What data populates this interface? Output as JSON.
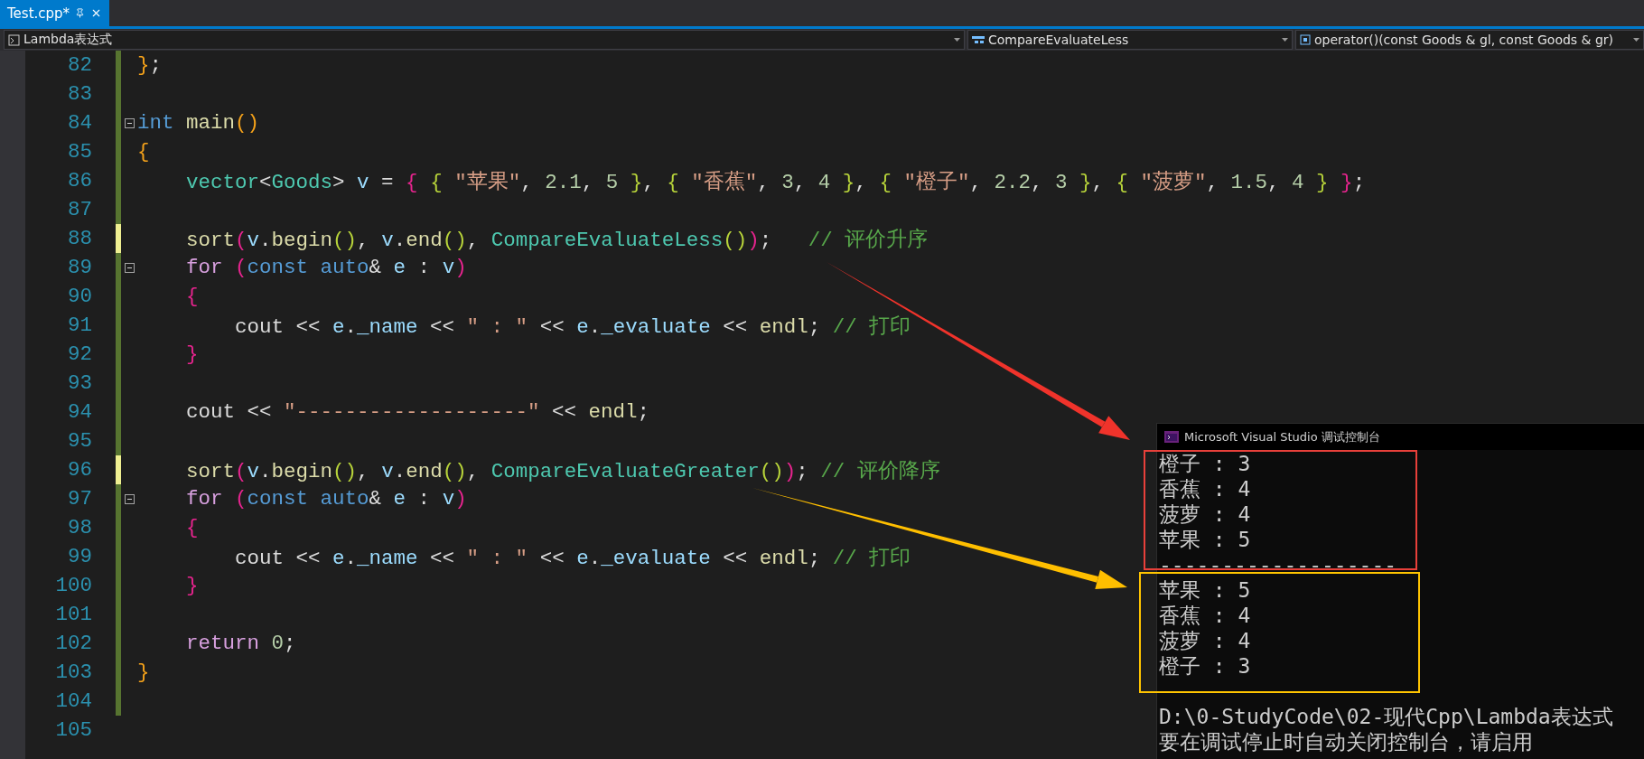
{
  "tab": {
    "label": "Test.cpp*",
    "selected": true
  },
  "navigation": [
    {
      "kind": "scope",
      "label": "Lambda表达式"
    },
    {
      "kind": "class",
      "label": "CompareEvaluateLess"
    },
    {
      "kind": "member",
      "label": "operator()(const Goods & gl, const Goods & gr)"
    }
  ],
  "lines": [
    {
      "number": "82",
      "fold": false,
      "changed": true,
      "unsaved": false,
      "tokens": [
        {
          "kind": "bracket1",
          "text": "}"
        },
        {
          "kind": "plain",
          "text": ";"
        }
      ]
    },
    {
      "number": "83",
      "fold": false,
      "changed": true,
      "unsaved": false
    },
    {
      "number": "84",
      "fold": true,
      "changed": true,
      "unsaved": false,
      "tokens": [
        {
          "kind": "keyword",
          "text": "int "
        },
        {
          "kind": "function",
          "text": "main"
        },
        {
          "kind": "bracket1",
          "text": "()"
        }
      ]
    },
    {
      "number": "85",
      "fold": false,
      "changed": true,
      "unsaved": false,
      "tokens": [
        {
          "kind": "bracket1",
          "text": "{"
        }
      ]
    },
    {
      "number": "86",
      "fold": false,
      "changed": true,
      "unsaved": false,
      "tokens": [
        {
          "kind": "type",
          "text": "    vector"
        },
        {
          "kind": "plain",
          "text": "<"
        },
        {
          "kind": "type",
          "text": "Goods"
        },
        {
          "kind": "plain",
          "text": "> "
        },
        {
          "kind": "variable",
          "text": "v"
        },
        {
          "kind": "plain",
          "text": " = "
        },
        {
          "kind": "bracket2",
          "text": "{ "
        },
        {
          "kind": "bracket3",
          "text": "{ "
        },
        {
          "kind": "string",
          "text": "\"苹果\""
        },
        {
          "kind": "plain",
          "text": ", "
        },
        {
          "kind": "number",
          "text": "2.1"
        },
        {
          "kind": "plain",
          "text": ", "
        },
        {
          "kind": "number",
          "text": "5 "
        },
        {
          "kind": "bracket3",
          "text": "}"
        },
        {
          "kind": "plain",
          "text": ", "
        },
        {
          "kind": "bracket3",
          "text": "{ "
        },
        {
          "kind": "string",
          "text": "\"香蕉\""
        },
        {
          "kind": "plain",
          "text": ", "
        },
        {
          "kind": "number",
          "text": "3"
        },
        {
          "kind": "plain",
          "text": ", "
        },
        {
          "kind": "number",
          "text": "4 "
        },
        {
          "kind": "bracket3",
          "text": "}"
        },
        {
          "kind": "plain",
          "text": ", "
        },
        {
          "kind": "bracket3",
          "text": "{ "
        },
        {
          "kind": "string",
          "text": "\"橙子\""
        },
        {
          "kind": "plain",
          "text": ", "
        },
        {
          "kind": "number",
          "text": "2.2"
        },
        {
          "kind": "plain",
          "text": ", "
        },
        {
          "kind": "number",
          "text": "3 "
        },
        {
          "kind": "bracket3",
          "text": "}"
        },
        {
          "kind": "plain",
          "text": ", "
        },
        {
          "kind": "bracket3",
          "text": "{ "
        },
        {
          "kind": "string",
          "text": "\"菠萝\""
        },
        {
          "kind": "plain",
          "text": ", "
        },
        {
          "kind": "number",
          "text": "1.5"
        },
        {
          "kind": "plain",
          "text": ", "
        },
        {
          "kind": "number",
          "text": "4 "
        },
        {
          "kind": "bracket3",
          "text": "} "
        },
        {
          "kind": "bracket2",
          "text": "}"
        },
        {
          "kind": "plain",
          "text": ";"
        }
      ]
    },
    {
      "number": "87",
      "fold": false,
      "changed": true,
      "unsaved": false
    },
    {
      "number": "88",
      "fold": false,
      "changed": true,
      "unsaved": true,
      "tokens": [
        {
          "kind": "function",
          "text": "    sort"
        },
        {
          "kind": "bracket2",
          "text": "("
        },
        {
          "kind": "variable",
          "text": "v"
        },
        {
          "kind": "plain",
          "text": "."
        },
        {
          "kind": "function",
          "text": "begin"
        },
        {
          "kind": "bracket3",
          "text": "()"
        },
        {
          "kind": "plain",
          "text": ", "
        },
        {
          "kind": "variable",
          "text": "v"
        },
        {
          "kind": "plain",
          "text": "."
        },
        {
          "kind": "function",
          "text": "end"
        },
        {
          "kind": "bracket3",
          "text": "()"
        },
        {
          "kind": "plain",
          "text": ", "
        },
        {
          "kind": "type",
          "text": "CompareEvaluateLess"
        },
        {
          "kind": "bracket3",
          "text": "()"
        },
        {
          "kind": "bracket2",
          "text": ")"
        },
        {
          "kind": "plain",
          "text": ";   "
        },
        {
          "kind": "comment",
          "text": "// 评价升序"
        }
      ]
    },
    {
      "number": "89",
      "fold": true,
      "changed": true,
      "unsaved": false,
      "tokens": [
        {
          "kind": "control",
          "text": "    for "
        },
        {
          "kind": "bracket2",
          "text": "("
        },
        {
          "kind": "keyword",
          "text": "const auto"
        },
        {
          "kind": "plain",
          "text": "& "
        },
        {
          "kind": "variable",
          "text": "e"
        },
        {
          "kind": "plain",
          "text": " : "
        },
        {
          "kind": "variable",
          "text": "v"
        },
        {
          "kind": "bracket2",
          "text": ")"
        }
      ]
    },
    {
      "number": "90",
      "fold": false,
      "changed": true,
      "unsaved": false,
      "tokens": [
        {
          "kind": "bracket2",
          "text": "    {"
        }
      ]
    },
    {
      "number": "91",
      "fold": false,
      "changed": true,
      "unsaved": false,
      "tokens": [
        {
          "kind": "plain",
          "text": "        cout << "
        },
        {
          "kind": "variable",
          "text": "e"
        },
        {
          "kind": "plain",
          "text": "."
        },
        {
          "kind": "variable",
          "text": "_name"
        },
        {
          "kind": "plain",
          "text": " << "
        },
        {
          "kind": "string",
          "text": "\" : \""
        },
        {
          "kind": "plain",
          "text": " << "
        },
        {
          "kind": "variable",
          "text": "e"
        },
        {
          "kind": "plain",
          "text": "."
        },
        {
          "kind": "variable",
          "text": "_evaluate"
        },
        {
          "kind": "plain",
          "text": " << "
        },
        {
          "kind": "function",
          "text": "endl"
        },
        {
          "kind": "plain",
          "text": "; "
        },
        {
          "kind": "comment",
          "text": "// 打印"
        }
      ]
    },
    {
      "number": "92",
      "fold": false,
      "changed": true,
      "unsaved": false,
      "tokens": [
        {
          "kind": "bracket2",
          "text": "    }"
        }
      ]
    },
    {
      "number": "93",
      "fold": false,
      "changed": true,
      "unsaved": false
    },
    {
      "number": "94",
      "fold": false,
      "changed": true,
      "unsaved": false,
      "tokens": [
        {
          "kind": "plain",
          "text": "    cout << "
        },
        {
          "kind": "string",
          "text": "\"-------------------\""
        },
        {
          "kind": "plain",
          "text": " << "
        },
        {
          "kind": "function",
          "text": "endl"
        },
        {
          "kind": "plain",
          "text": ";"
        }
      ]
    },
    {
      "number": "95",
      "fold": false,
      "changed": true,
      "unsaved": false
    },
    {
      "number": "96",
      "fold": false,
      "changed": true,
      "unsaved": true,
      "tokens": [
        {
          "kind": "function",
          "text": "    sort"
        },
        {
          "kind": "bracket2",
          "text": "("
        },
        {
          "kind": "variable",
          "text": "v"
        },
        {
          "kind": "plain",
          "text": "."
        },
        {
          "kind": "function",
          "text": "begin"
        },
        {
          "kind": "bracket3",
          "text": "()"
        },
        {
          "kind": "plain",
          "text": ", "
        },
        {
          "kind": "variable",
          "text": "v"
        },
        {
          "kind": "plain",
          "text": "."
        },
        {
          "kind": "function",
          "text": "end"
        },
        {
          "kind": "bracket3",
          "text": "()"
        },
        {
          "kind": "plain",
          "text": ", "
        },
        {
          "kind": "type",
          "text": "CompareEvaluateGreater"
        },
        {
          "kind": "bracket3",
          "text": "()"
        },
        {
          "kind": "bracket2",
          "text": ")"
        },
        {
          "kind": "plain",
          "text": "; "
        },
        {
          "kind": "comment",
          "text": "// 评价降序"
        }
      ]
    },
    {
      "number": "97",
      "fold": true,
      "changed": true,
      "unsaved": false,
      "tokens": [
        {
          "kind": "control",
          "text": "    for "
        },
        {
          "kind": "bracket2",
          "text": "("
        },
        {
          "kind": "keyword",
          "text": "const auto"
        },
        {
          "kind": "plain",
          "text": "& "
        },
        {
          "kind": "variable",
          "text": "e"
        },
        {
          "kind": "plain",
          "text": " : "
        },
        {
          "kind": "variable",
          "text": "v"
        },
        {
          "kind": "bracket2",
          "text": ")"
        }
      ]
    },
    {
      "number": "98",
      "fold": false,
      "changed": true,
      "unsaved": false,
      "tokens": [
        {
          "kind": "bracket2",
          "text": "    {"
        }
      ]
    },
    {
      "number": "99",
      "fold": false,
      "changed": true,
      "unsaved": false,
      "tokens": [
        {
          "kind": "plain",
          "text": "        cout << "
        },
        {
          "kind": "variable",
          "text": "e"
        },
        {
          "kind": "plain",
          "text": "."
        },
        {
          "kind": "variable",
          "text": "_name"
        },
        {
          "kind": "plain",
          "text": " << "
        },
        {
          "kind": "string",
          "text": "\" : \""
        },
        {
          "kind": "plain",
          "text": " << "
        },
        {
          "kind": "variable",
          "text": "e"
        },
        {
          "kind": "plain",
          "text": "."
        },
        {
          "kind": "variable",
          "text": "_evaluate"
        },
        {
          "kind": "plain",
          "text": " << "
        },
        {
          "kind": "function",
          "text": "endl"
        },
        {
          "kind": "plain",
          "text": "; "
        },
        {
          "kind": "comment",
          "text": "// 打印"
        }
      ]
    },
    {
      "number": "100",
      "fold": false,
      "changed": true,
      "unsaved": false,
      "tokens": [
        {
          "kind": "bracket2",
          "text": "    }"
        }
      ]
    },
    {
      "number": "101",
      "fold": false,
      "changed": true,
      "unsaved": false
    },
    {
      "number": "102",
      "fold": false,
      "changed": true,
      "unsaved": false,
      "tokens": [
        {
          "kind": "control",
          "text": "    return "
        },
        {
          "kind": "number",
          "text": "0"
        },
        {
          "kind": "plain",
          "text": ";"
        }
      ]
    },
    {
      "number": "103",
      "fold": false,
      "changed": true,
      "unsaved": false,
      "tokens": [
        {
          "kind": "bracket1",
          "text": "}"
        }
      ]
    },
    {
      "number": "104",
      "fold": false,
      "changed": true,
      "unsaved": false
    },
    {
      "number": "105",
      "fold": false,
      "changed": false
    }
  ],
  "console": {
    "title": "Microsoft Visual Studio 调试控制台",
    "output_lines": [
      "橙子 : 3",
      "香蕉 : 4",
      "菠萝 : 4",
      "苹果 : 5",
      "-------------------",
      "苹果 : 5",
      "香蕉 : 4",
      "菠萝 : 4",
      "橙子 : 3"
    ],
    "footer_lines": [
      "D:\\0-StudyCode\\02-现代Cpp\\Lambda表达式",
      "要在调试停止时自动关闭控制台，请启用"
    ]
  },
  "annotations": [
    {
      "kind": "box",
      "color": "#e8403a"
    },
    {
      "kind": "box",
      "color": "#ffc400"
    },
    {
      "kind": "arrow",
      "color": "#f0332b"
    },
    {
      "kind": "arrow",
      "color": "#ffbf00"
    }
  ]
}
